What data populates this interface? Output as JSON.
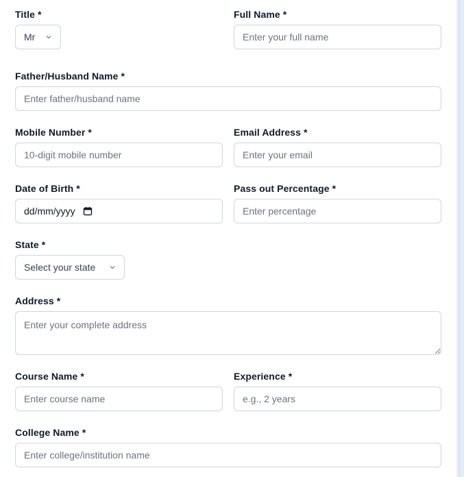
{
  "form": {
    "title": {
      "label": "Title *",
      "value": "Mr"
    },
    "full_name": {
      "label": "Full Name *",
      "placeholder": "Enter your full name"
    },
    "father_name": {
      "label": "Father/Husband Name *",
      "placeholder": "Enter father/husband name"
    },
    "mobile": {
      "label": "Mobile Number *",
      "placeholder": "10-digit mobile number"
    },
    "email": {
      "label": "Email Address *",
      "placeholder": "Enter your email"
    },
    "dob": {
      "label": "Date of Birth *",
      "format": "dd/mm/yyyy"
    },
    "percentage": {
      "label": "Pass out Percentage *",
      "placeholder": "Enter percentage"
    },
    "state": {
      "label": "State *",
      "value": "Select your state"
    },
    "address": {
      "label": "Address *",
      "placeholder": "Enter your complete address"
    },
    "course": {
      "label": "Course Name *",
      "placeholder": "Enter course name"
    },
    "experience": {
      "label": "Experience *",
      "placeholder": "e.g., 2 years"
    },
    "college": {
      "label": "College Name *",
      "placeholder": "Enter college/institution name"
    }
  },
  "icons": {
    "select": "chevron-down-icon",
    "date": "calendar-icon"
  },
  "colors": {
    "border": "#d1d5db",
    "label": "#111827",
    "placeholder": "#6b7280"
  }
}
